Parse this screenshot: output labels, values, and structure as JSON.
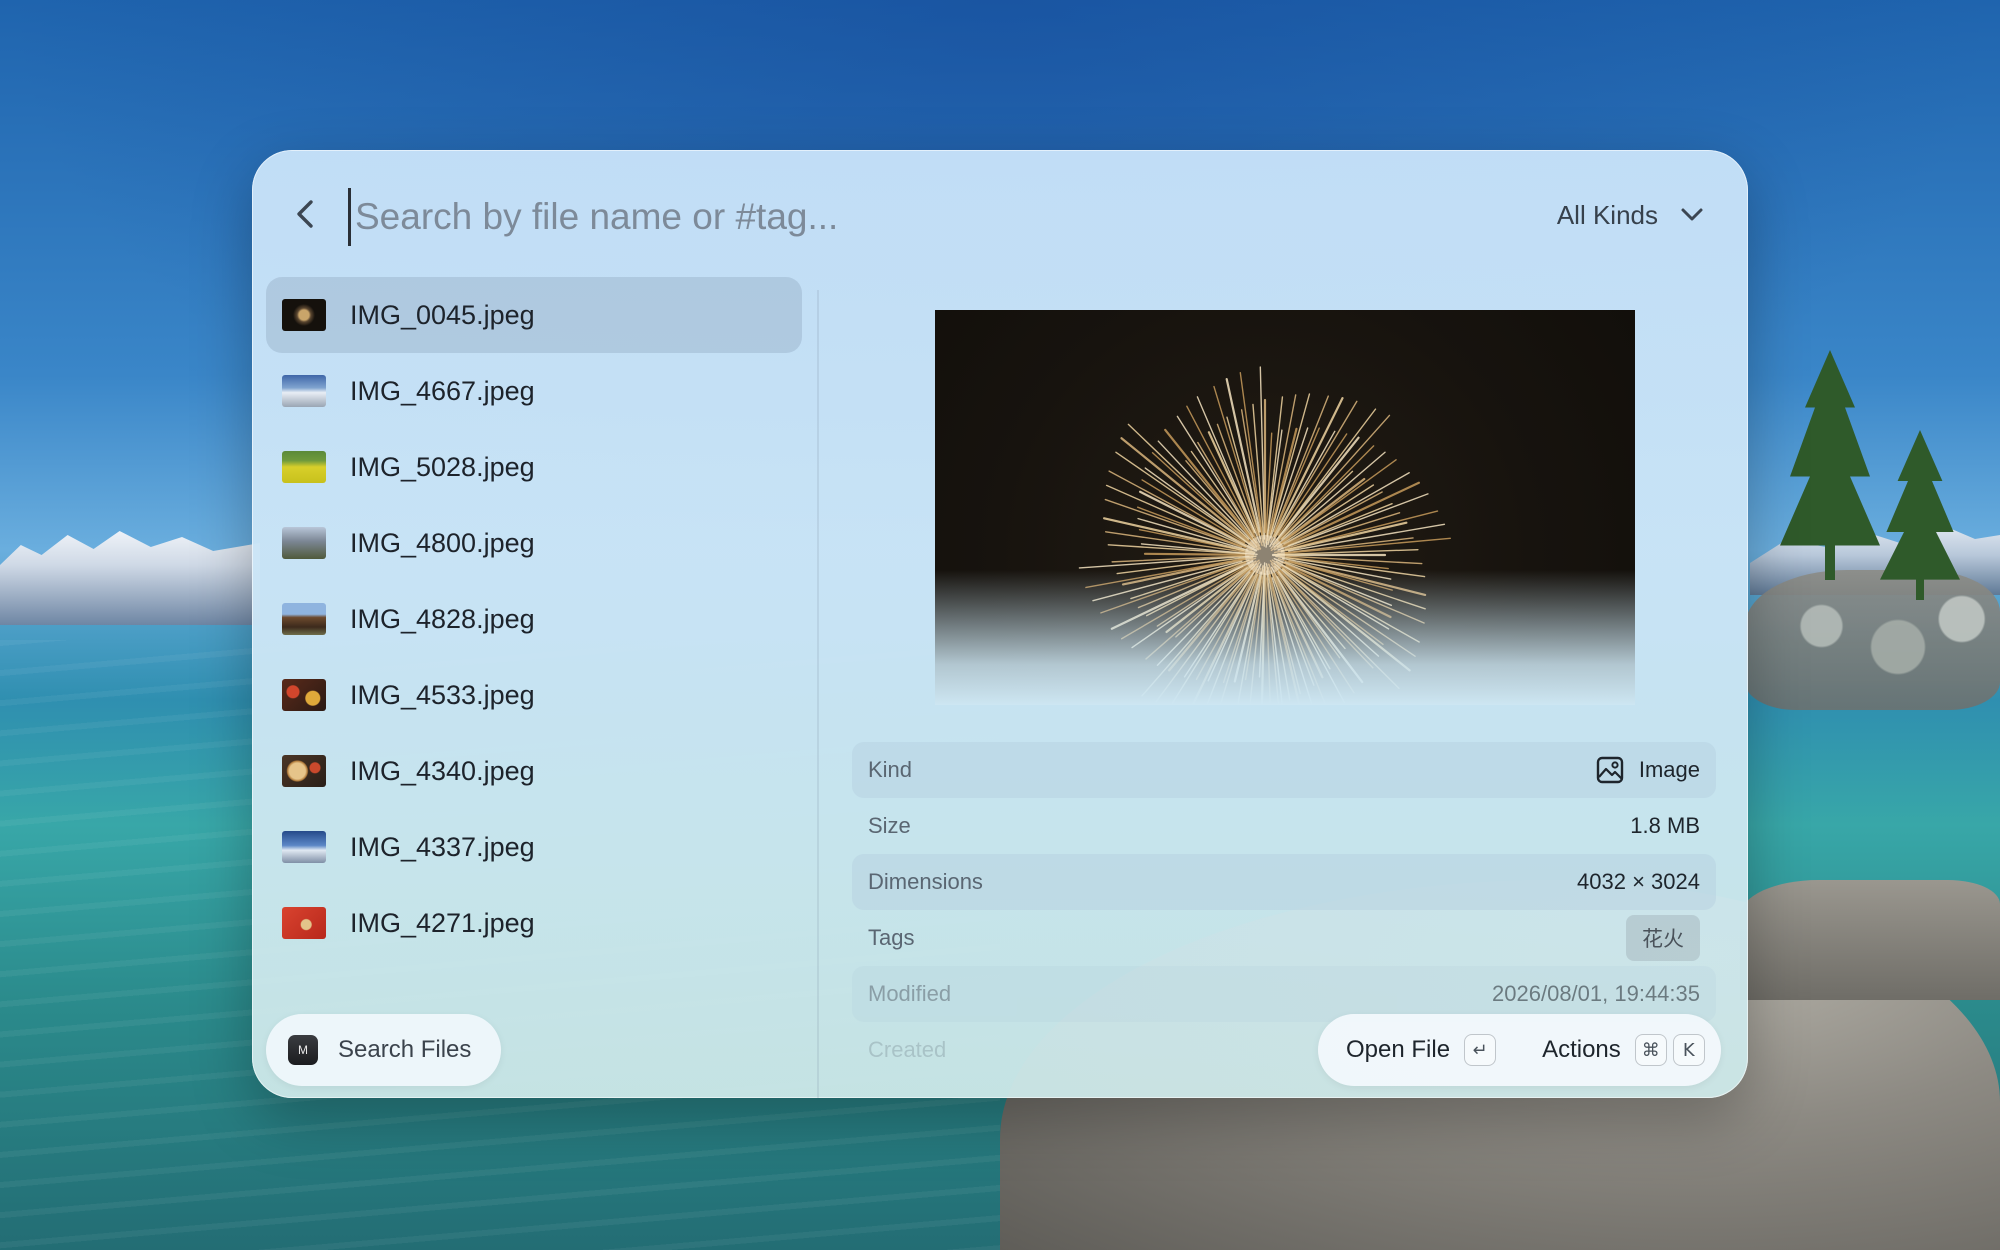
{
  "search": {
    "placeholder": "Search by file name or #tag..."
  },
  "filter": {
    "selected": "All Kinds"
  },
  "files": [
    {
      "name": "IMG_0045.jpeg",
      "thumb": "fireworks-thumbnail",
      "selected": true
    },
    {
      "name": "IMG_4667.jpeg",
      "thumb": "snowy-landscape-thumbnail",
      "selected": false
    },
    {
      "name": "IMG_5028.jpeg",
      "thumb": "yellow-field-thumbnail",
      "selected": false
    },
    {
      "name": "IMG_4800.jpeg",
      "thumb": "street-thumbnail",
      "selected": false
    },
    {
      "name": "IMG_4828.jpeg",
      "thumb": "building-thumbnail",
      "selected": false
    },
    {
      "name": "IMG_4533.jpeg",
      "thumb": "colorful-food-thumbnail",
      "selected": false
    },
    {
      "name": "IMG_4340.jpeg",
      "thumb": "dishes-thumbnail",
      "selected": false
    },
    {
      "name": "IMG_4337.jpeg",
      "thumb": "mountain-sky-thumbnail",
      "selected": false
    },
    {
      "name": "IMG_4271.jpeg",
      "thumb": "red-deer-thumbnail",
      "selected": false
    }
  ],
  "details": {
    "kind": {
      "label": "Kind",
      "value": "Image",
      "icon": "image-icon"
    },
    "size": {
      "label": "Size",
      "value": "1.8 MB"
    },
    "dimensions": {
      "label": "Dimensions",
      "value": "4032 × 3024"
    },
    "tags": {
      "label": "Tags",
      "value": "花火"
    },
    "modified": {
      "label": "Modified",
      "value": "2026/08/01, 19:44:35"
    },
    "created": {
      "label": "Created",
      "value": ""
    }
  },
  "footer": {
    "app_icon_text": "M",
    "app_name": "Search Files",
    "open_file": "Open File",
    "open_key": "↵",
    "actions": "Actions",
    "actions_key_mod": "⌘",
    "actions_key": "K"
  },
  "colors": {
    "accent_selected_row": "#96afc8",
    "window_bg": "#c6e1f8",
    "text_primary": "#1d232b"
  }
}
